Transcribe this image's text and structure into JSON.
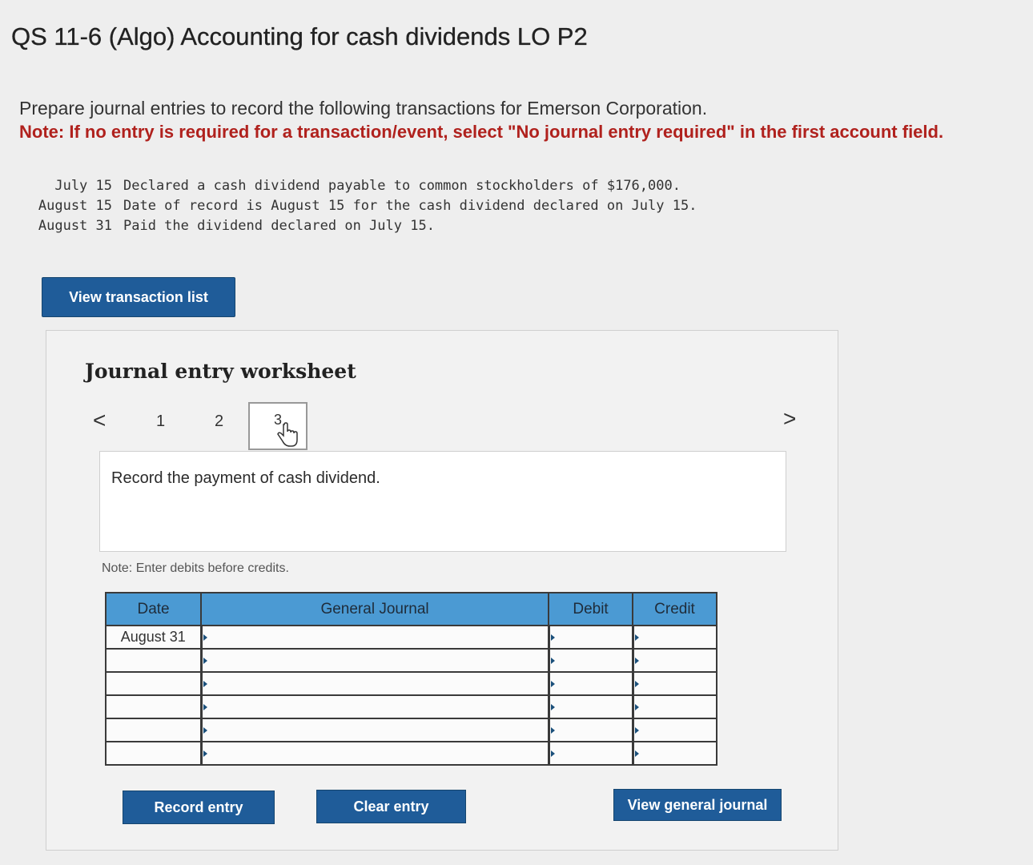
{
  "header": {
    "title": "QS 11-6 (Algo) Accounting for cash dividends LO P2",
    "instruction": "Prepare journal entries to record the following transactions for Emerson Corporation.",
    "note": "Note: If no entry is required for a transaction/event, select \"No journal entry required\" in the first account field."
  },
  "transactions": [
    {
      "date": "July 15",
      "text": "Declared a cash dividend payable to common stockholders of $176,000."
    },
    {
      "date": "August 15",
      "text": "Date of record is August 15 for the cash dividend declared on July 15."
    },
    {
      "date": "August 31",
      "text": "Paid the dividend declared on July 15."
    }
  ],
  "buttons": {
    "view_transaction_list": "View transaction list",
    "record_entry": "Record entry",
    "clear_entry": "Clear entry",
    "view_general_journal": "View general journal"
  },
  "worksheet": {
    "title": "Journal entry worksheet",
    "prev": "<",
    "next": ">",
    "tabs": [
      "1",
      "2",
      "3"
    ],
    "active_tab": "3",
    "description": "Record the payment of cash dividend.",
    "note": "Note: Enter debits before credits."
  },
  "journal": {
    "headers": [
      "Date",
      "General Journal",
      "Debit",
      "Credit"
    ],
    "rows": [
      {
        "date": "August 31",
        "account": "",
        "debit": "",
        "credit": ""
      },
      {
        "date": "",
        "account": "",
        "debit": "",
        "credit": ""
      },
      {
        "date": "",
        "account": "",
        "debit": "",
        "credit": ""
      },
      {
        "date": "",
        "account": "",
        "debit": "",
        "credit": ""
      },
      {
        "date": "",
        "account": "",
        "debit": "",
        "credit": ""
      },
      {
        "date": "",
        "account": "",
        "debit": "",
        "credit": ""
      }
    ]
  },
  "colors": {
    "button_bg": "#1f5c99",
    "table_header": "#4b9ad3",
    "note_red": "#b0211d"
  },
  "icons": {
    "pointer": "hand-pointer-icon"
  }
}
